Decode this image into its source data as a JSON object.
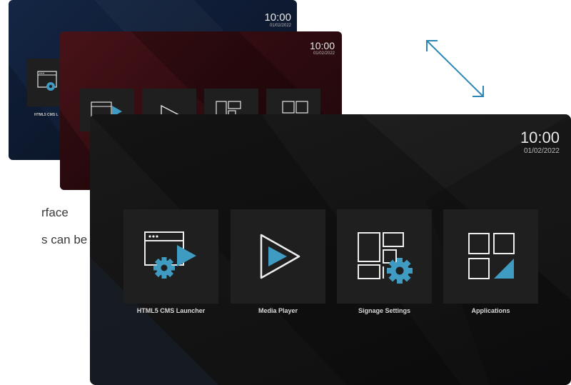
{
  "background_text": {
    "line1": "rface",
    "line2": "s can be"
  },
  "screens": {
    "blue": {
      "time": "10:00",
      "date": "01/02/2022",
      "label": "HTML5 CMS L"
    },
    "red": {
      "time": "10:00",
      "date": "01/02/2022"
    },
    "main": {
      "time": "10:00",
      "date": "01/02/2022",
      "tiles": [
        {
          "label": "HTML5 CMS Launcher"
        },
        {
          "label": "Media Player"
        },
        {
          "label": "Signage Settings"
        },
        {
          "label": "Applications"
        }
      ]
    }
  },
  "colors": {
    "accent": "#3f9bc1",
    "arrow": "#2e86b6",
    "blue_bg": "#0f1e38",
    "red_bg": "#3a0e12",
    "main_bg": "#121212",
    "tile_bg": "#1f1f1f"
  },
  "icons": [
    "resize-arrow-icon",
    "browser-gear-icon",
    "play-icon",
    "layout-gear-icon",
    "apps-grid-icon"
  ]
}
